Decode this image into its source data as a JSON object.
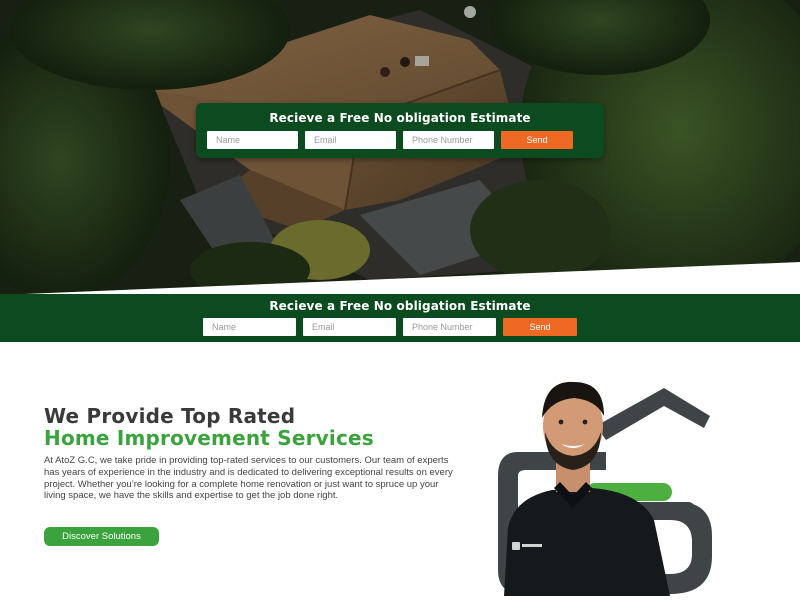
{
  "estimate_card": {
    "title": "Recieve a Free No obligation Estimate",
    "name_placeholder": "Name",
    "email_placeholder": "Email",
    "phone_placeholder": "Phone Number",
    "send_label": "Send"
  },
  "estimate_bar": {
    "title": "Recieve a Free No obligation Estimate",
    "name_placeholder": "Name",
    "email_placeholder": "Email",
    "phone_placeholder": "Phone Number",
    "send_label": "Send"
  },
  "about": {
    "heading_line1": "We Provide Top Rated",
    "heading_line2": "Home Improvement Services",
    "body": "At AtoZ G.C, we take pride in providing top-rated services to our customers. Our team of experts has years of experience in the industry and is dedicated to delivering exceptional results on every project. Whether you’re looking for a complete home renovation or just want to spruce up your living space, we have the skills and expertise to get the job done right.",
    "cta_label": "Discover Solutions"
  },
  "colors": {
    "brand_green_dark": "#0c4a1f",
    "brand_green": "#3ba33d",
    "accent_orange": "#ee6a24",
    "logo_gray": "#3f4447"
  },
  "icons": {
    "logo": "house-s-logo-icon"
  }
}
